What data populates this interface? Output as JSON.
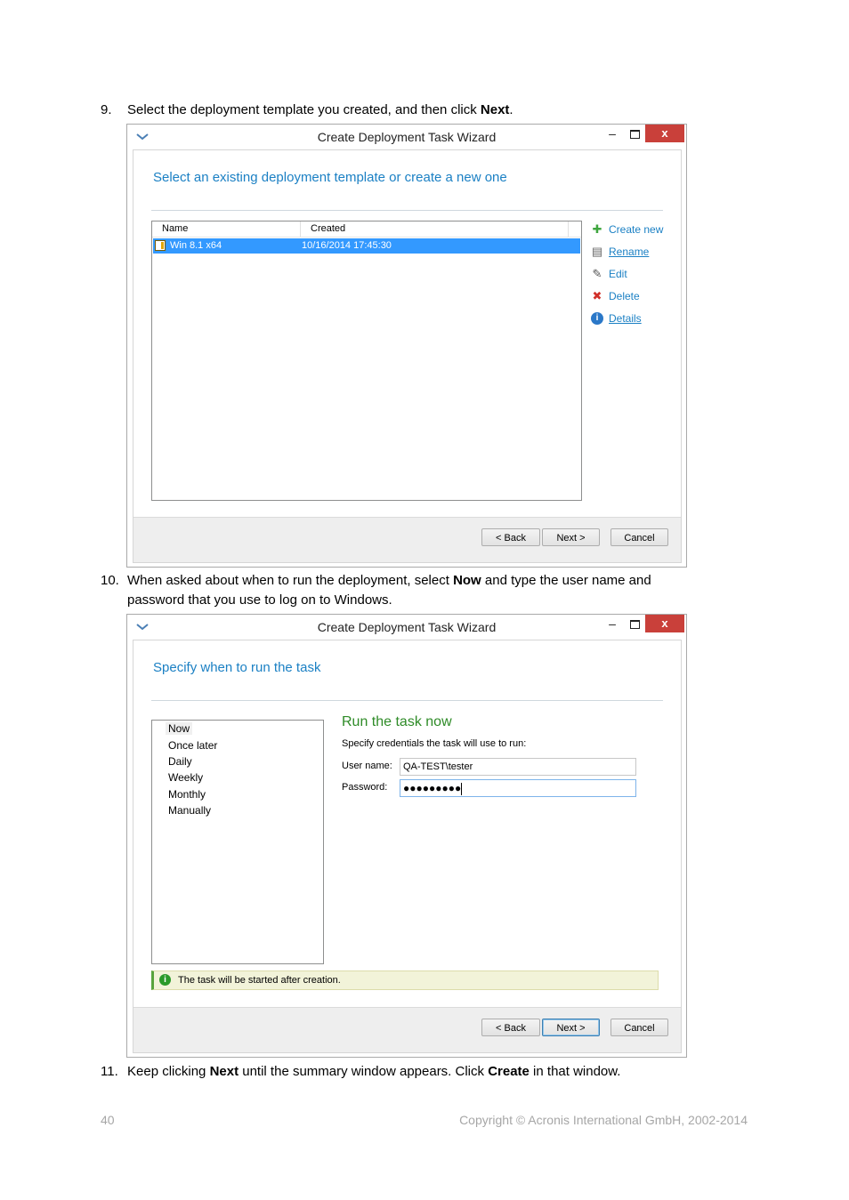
{
  "steps": {
    "s9": {
      "num": "9.",
      "pre": "Select the deployment template you created, and then click ",
      "bold": "Next",
      "post": "."
    },
    "s10": {
      "num": "10.",
      "pre": "When asked about when to run the deployment, select ",
      "bold": "Now",
      "post": " and type the user name and",
      "line2": "password that you use to log on to Windows."
    },
    "s11": {
      "num": "11.",
      "pre": "Keep clicking ",
      "bold1": "Next",
      "mid": " until the summary window appears. Click ",
      "bold2": "Create",
      "post": " in that window."
    }
  },
  "wizard1": {
    "title": "Create Deployment Task Wizard",
    "min": "–",
    "close": "x",
    "heading": "Select an existing deployment template or create a new one",
    "columns": [
      "Name",
      "Created"
    ],
    "rows": [
      {
        "name": "Win 8.1 x64",
        "created": "10/16/2014 17:45:30"
      }
    ],
    "actions": [
      {
        "label": "Create new",
        "icon": "plus-icon",
        "glyph": "✚",
        "color": "#3fa63f"
      },
      {
        "label": "Rename",
        "icon": "rename-icon",
        "glyph": "▤",
        "color": "#666666"
      },
      {
        "label": "Edit",
        "icon": "pencil-icon",
        "glyph": "✎",
        "color": "#555555"
      },
      {
        "label": "Delete",
        "icon": "delete-icon",
        "glyph": "✖",
        "color": "#d0302a"
      },
      {
        "label": "Details",
        "icon": "info-icon",
        "glyph": "i",
        "color": "#2b78c8"
      }
    ],
    "buttons": {
      "back": "< Back",
      "next": "Next >",
      "cancel": "Cancel"
    }
  },
  "wizard2": {
    "title": "Create Deployment Task Wizard",
    "min": "–",
    "close": "x",
    "heading": "Specify when to run the task",
    "schedule": [
      "Now",
      "Once later",
      "Daily",
      "Weekly",
      "Monthly",
      "Manually"
    ],
    "selected": "Now",
    "run_title": "Run the task now",
    "cred_text": "Specify credentials the task will use to run:",
    "username_label": "User name:",
    "username_value": "QA-TEST\\tester",
    "password_label": "Password:",
    "password_value": "●●●●●●●●●",
    "info": "The task will be started after creation.",
    "buttons": {
      "back": "< Back",
      "next": "Next >",
      "cancel": "Cancel"
    }
  },
  "footer": {
    "page": "40",
    "copyright": "Copyright © Acronis International GmbH, 2002-2014"
  }
}
